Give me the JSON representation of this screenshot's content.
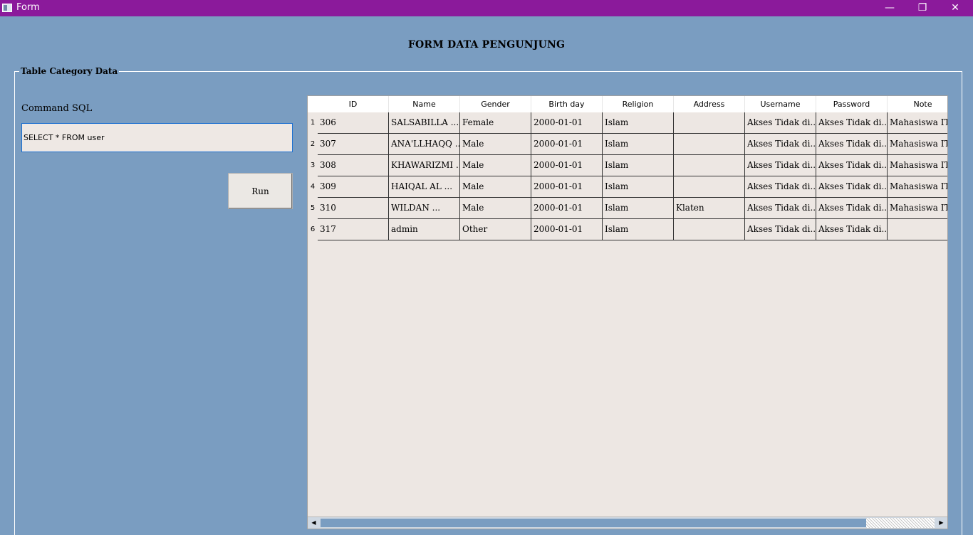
{
  "window": {
    "title": "Form",
    "min_icon": "minimize-icon",
    "max_icon": "restore-icon",
    "close_icon": "close-icon"
  },
  "heading": "FORM DATA PENGUNJUNG",
  "group": {
    "legend": "Table Category Data"
  },
  "command": {
    "label": "Command SQL",
    "value": "SELECT * FROM user"
  },
  "run": {
    "label": "Run"
  },
  "table": {
    "columns": [
      "ID",
      "Name",
      "Gender",
      "Birth day",
      "Religion",
      "Address",
      "Username",
      "Password",
      "Note"
    ],
    "rows": [
      {
        "num": "1",
        "cells": [
          "306",
          "SALSABILLA ...",
          "Female",
          "2000-01-01",
          "Islam",
          "",
          "Akses Tidak di...",
          "Akses Tidak di...",
          "Mahasiswa IT..."
        ]
      },
      {
        "num": "2",
        "cells": [
          "307",
          "ANA'LLHAQQ ...",
          "Male",
          "2000-01-01",
          "Islam",
          "",
          "Akses Tidak di...",
          "Akses Tidak di...",
          "Mahasiswa IT..."
        ]
      },
      {
        "num": "3",
        "cells": [
          "308",
          "KHAWARIZMI ...",
          "Male",
          "2000-01-01",
          "Islam",
          "",
          "Akses Tidak di...",
          "Akses Tidak di...",
          "Mahasiswa IT..."
        ]
      },
      {
        "num": "4",
        "cells": [
          "309",
          "HAIQAL AL ...",
          "Male",
          "2000-01-01",
          "Islam",
          "",
          "Akses Tidak di...",
          "Akses Tidak di...",
          "Mahasiswa IT..."
        ]
      },
      {
        "num": "5",
        "cells": [
          "310",
          "WILDAN ...",
          "Male",
          "2000-01-01",
          "Islam",
          "Klaten",
          "Akses Tidak di...",
          "Akses Tidak di...",
          "Mahasiswa IT..."
        ]
      },
      {
        "num": "6",
        "cells": [
          "317",
          "admin",
          "Other",
          "2000-01-01",
          "Islam",
          "",
          "Akses Tidak di...",
          "Akses Tidak di...",
          ""
        ]
      }
    ]
  },
  "colors": {
    "titlebar": "#8b1a9b",
    "background": "#7a9dc1",
    "grid": "#ede7e3"
  }
}
